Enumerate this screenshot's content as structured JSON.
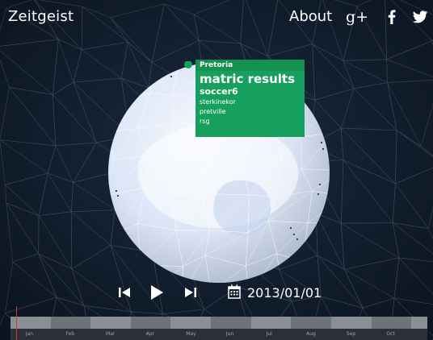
{
  "header": {
    "logo": "Zeitgeist",
    "about": "About",
    "gplus_text": "g+"
  },
  "popup": {
    "city": "Pretoria",
    "rank1": "matric results",
    "rank2": "soccer6",
    "items": [
      "sterkinekor",
      "pretville",
      "rsg"
    ]
  },
  "controls": {
    "date": "2013/01/01"
  },
  "timeline": {
    "months": [
      "Jan",
      "Feb",
      "Mar",
      "Apr",
      "May",
      "Jun",
      "Jul",
      "Aug",
      "Sep",
      "Oct"
    ],
    "playhead_fraction": 0.0
  },
  "colors": {
    "popup": "#17a05d",
    "background": "#0f1a2a",
    "cursor": "#d23b2f",
    "globe": "#dfe8f7"
  },
  "icons": [
    "google-plus-icon",
    "facebook-icon",
    "twitter-icon",
    "skip-back-icon",
    "play-icon",
    "skip-forward-icon",
    "calendar-icon"
  ]
}
